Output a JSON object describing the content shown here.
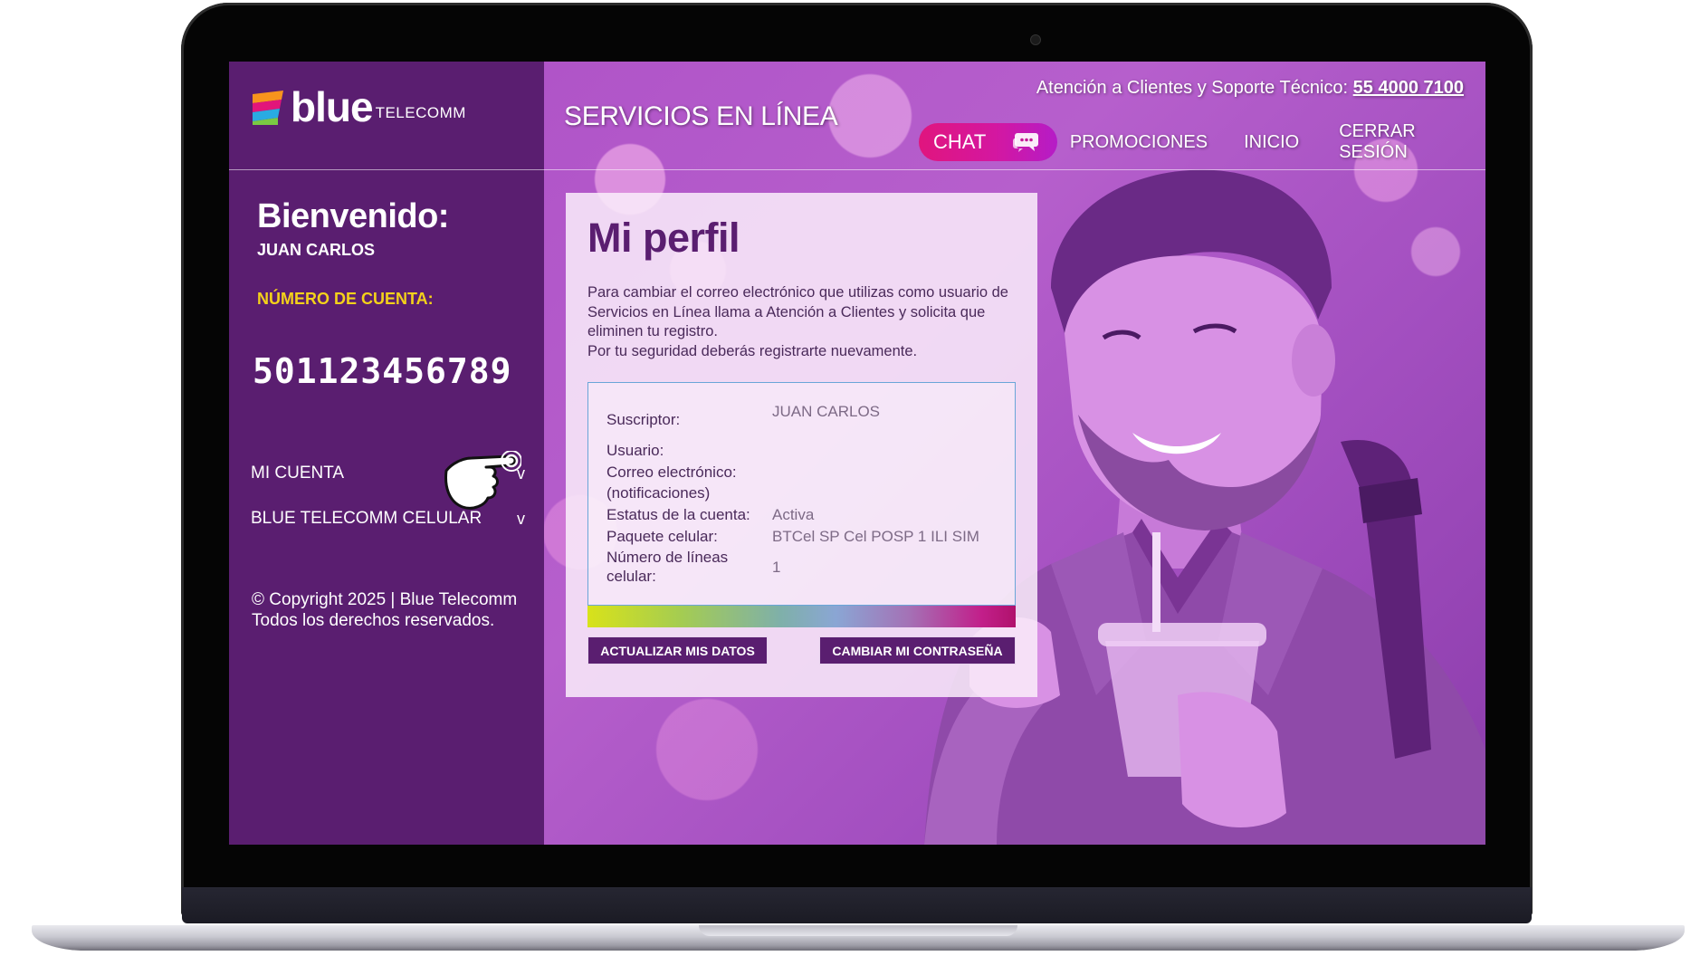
{
  "header": {
    "logo_brand": "blue",
    "logo_sub": "TELECOMM",
    "site_title": "SERVICIOS EN LÍNEA",
    "support_label": "Atención a Clientes y Soporte Técnico:",
    "support_phone": "55 4000 7100"
  },
  "nav": {
    "chat": "CHAT",
    "promociones": "PROMOCIONES",
    "inicio": "INICIO",
    "cerrar": "CERRAR SESIÓN"
  },
  "sidebar": {
    "welcome": "Bienvenido:",
    "username": "JUAN CARLOS",
    "account_label": "NÚMERO DE CUENTA:",
    "account_number": "501123456789",
    "menu": [
      {
        "label": "MI CUENTA",
        "chevron": "v"
      },
      {
        "label": "BLUE TELECOMM CELULAR",
        "chevron": "v"
      }
    ],
    "copyright_line1": "© Copyright 2025 | Blue Telecomm",
    "copyright_line2": "Todos los derechos reservados."
  },
  "profile": {
    "title": "Mi perfil",
    "description": "Para cambiar el correo electrónico que utilizas como usuario de Servicios en Línea llama a Atención a Clientes y solicita que eliminen tu registro.",
    "description2": "Por tu seguridad deberás registrarte nuevamente.",
    "fields": {
      "suscriptor_label": "Suscriptor:",
      "suscriptor_value": "JUAN CARLOS",
      "usuario_label": "Usuario:",
      "usuario_value": "",
      "correo_label": "Correo electrónico:",
      "correo_label2": "(notificaciones)",
      "correo_value": "",
      "estatus_label": "Estatus de la cuenta:",
      "estatus_value": "Activa",
      "paquete_label": "Paquete celular:",
      "paquete_value": "BTCel SP Cel POSP 1 ILI SIM",
      "lineas_label": "Número de líneas",
      "lineas_label2": "celular:",
      "lineas_value": "1"
    },
    "btn_update": "ACTUALIZAR MIS DATOS",
    "btn_password": "CAMBIAR MI CONTRASEÑA"
  },
  "colors": {
    "brand_purple": "#5a1e70",
    "account_label_yellow": "#f4d21a",
    "chat_pink": "#e0157e"
  },
  "icons": [
    "logo-mark-icon",
    "chat-bubble-icon",
    "pointing-hand-icon"
  ]
}
